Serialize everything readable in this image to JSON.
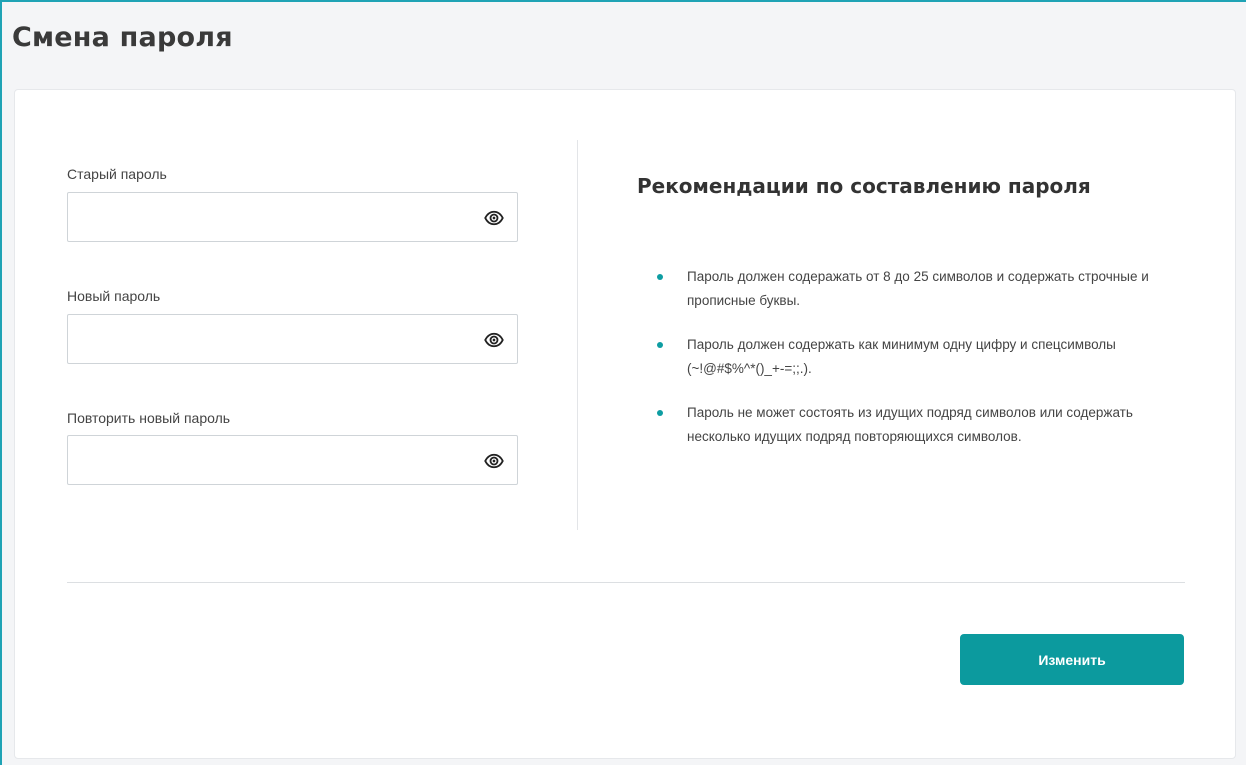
{
  "page": {
    "title": "Смена пароля"
  },
  "form": {
    "fields": [
      {
        "label": "Старый пароль",
        "value": "",
        "placeholder": ""
      },
      {
        "label": "Новый пароль",
        "value": "",
        "placeholder": ""
      },
      {
        "label": "Повторить новый пароль",
        "value": "",
        "placeholder": ""
      }
    ],
    "show_password_icon": "eye-icon"
  },
  "recommendations": {
    "title": "Рекомендации по составлению пароля",
    "items": [
      "Пароль должен содеражать от 8 до 25 символов и содержать строчные и прописные буквы.",
      "Пароль должен содержать как минимум одну цифру и спецсимволы (~!@#$%^*()_+-=;;.).",
      "Пароль не может состоять из идущих подряд символов или содержать несколько идущих подряд повторяющихся символов."
    ]
  },
  "actions": {
    "submit_label": "Изменить"
  },
  "colors": {
    "accent": "#0c9a9e",
    "frame": "#1fa3b5",
    "bullet": "#0e9da2"
  }
}
